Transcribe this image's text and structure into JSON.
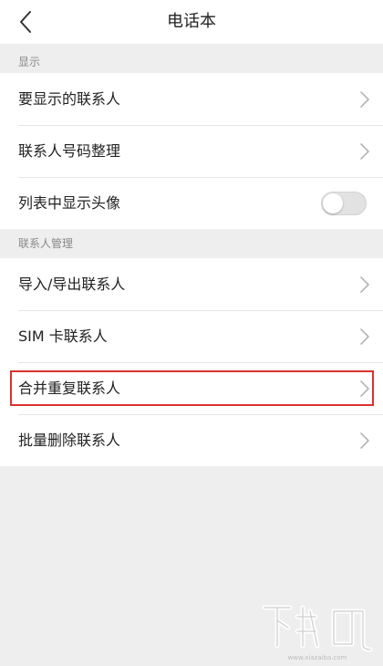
{
  "header": {
    "title": "电话本",
    "back_icon": "back-arrow-icon"
  },
  "sections": [
    {
      "title": "显示",
      "items": [
        {
          "label": "要显示的联系人",
          "trailing": "chevron"
        },
        {
          "label": "联系人号码整理",
          "trailing": "chevron"
        },
        {
          "label": "列表中显示头像",
          "trailing": "toggle",
          "toggle_on": false
        }
      ]
    },
    {
      "title": "联系人管理",
      "items": [
        {
          "label": "导入/导出联系人",
          "trailing": "chevron"
        },
        {
          "label": "SIM 卡联系人",
          "trailing": "chevron"
        },
        {
          "label": "合并重复联系人",
          "trailing": "chevron",
          "highlighted": true
        },
        {
          "label": "批量删除联系人",
          "trailing": "chevron"
        }
      ]
    }
  ],
  "annotation": {
    "highlight_color": "#d9332e"
  },
  "watermark": {
    "logo_text": "下载吧",
    "url": "www.xiazaiba.com"
  },
  "colors": {
    "background": "#eeeeee",
    "card": "#ffffff",
    "section_title": "#888888",
    "text": "#222222",
    "chevron": "#b5b5b5"
  }
}
